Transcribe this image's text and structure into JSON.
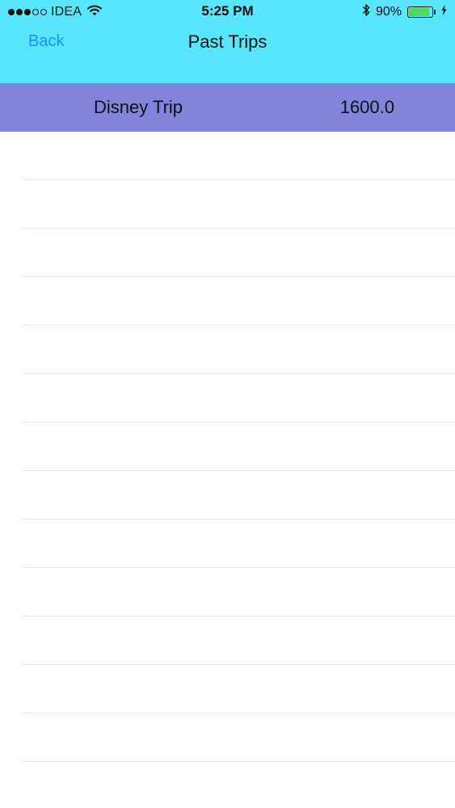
{
  "status_bar": {
    "carrier": "IDEA",
    "signal_bars_filled": 3,
    "signal_bars_total": 5,
    "time": "5:25 PM",
    "battery_percent": "90%",
    "battery_level": 0.9,
    "icons": [
      "signal-dots-icon",
      "wifi-icon",
      "bluetooth-icon",
      "battery-icon",
      "charging-bolt-icon"
    ]
  },
  "nav": {
    "back_label": "Back",
    "title": "Past Trips"
  },
  "trips": [
    {
      "name": "Disney Trip",
      "amount": "1600.0"
    }
  ],
  "colors": {
    "header_background": "#57e6fd",
    "back_link": "#1f8ef5",
    "selected_row": "#8383dc",
    "battery_fill": "#4cd964",
    "separator": "#e3e3e6",
    "background": "#ffffff"
  }
}
